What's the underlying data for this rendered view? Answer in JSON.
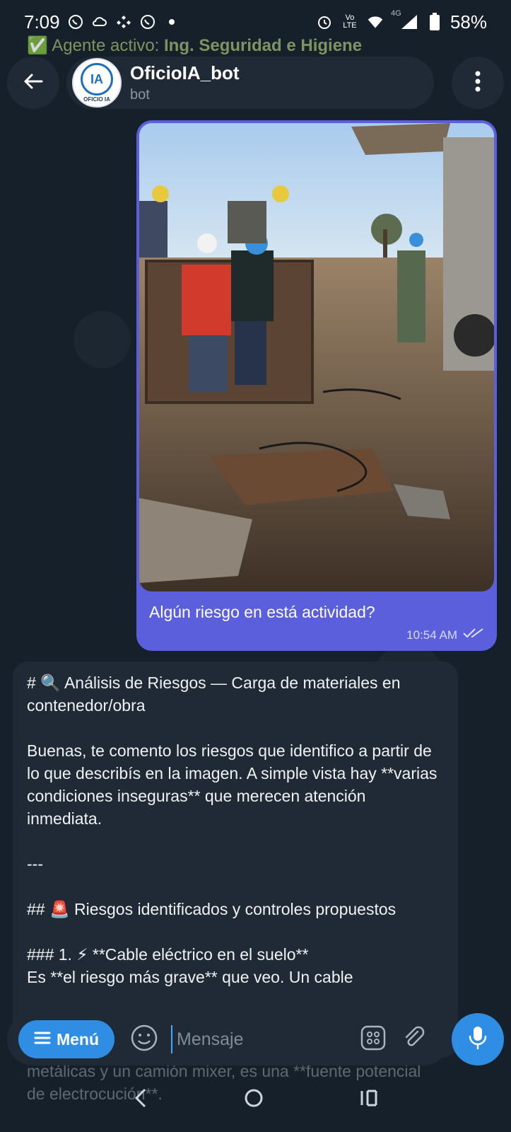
{
  "status_bar": {
    "time": "7:09",
    "battery": "58%",
    "network": "4G",
    "lte": "Vo LTE"
  },
  "pinned": {
    "prefix": "Agente activo:",
    "value": "Ing. Seguridad e Higiene"
  },
  "header": {
    "title": "OficioIA_bot",
    "subtitle": "bot",
    "avatar_letters": "IA",
    "avatar_text": "OFICIO IA"
  },
  "outgoing": {
    "caption": "Algún riesgo en  está actividad?",
    "time": "10:54 AM"
  },
  "incoming": {
    "lines": [
      "# 🔍 Análisis de Riesgos — Carga de materiales en contenedor/obra",
      "",
      "Buenas, te comento los riesgos que identifico a partir de lo que describís en la imagen. A simple vista hay **varias condiciones inseguras** que merecen atención inmediata.",
      "",
      "---",
      "",
      "## 🚨 Riesgos identificados y controles propuestos",
      "",
      "### 1. ⚡ **Cable eléctrico en el suelo**",
      "Es **el riesgo más grave** que veo. Un cable"
    ],
    "hidden_tail": "metálicas y un camión mixer, es una **fuente potencial de electrocución**."
  },
  "composer": {
    "menu_label": "Menú",
    "placeholder": "Mensaje"
  },
  "colors": {
    "accent": "#2f8de4",
    "outgoing_bubble": "#5b5fdc",
    "incoming_bubble": "#1f2a36",
    "background": "#16202b"
  }
}
